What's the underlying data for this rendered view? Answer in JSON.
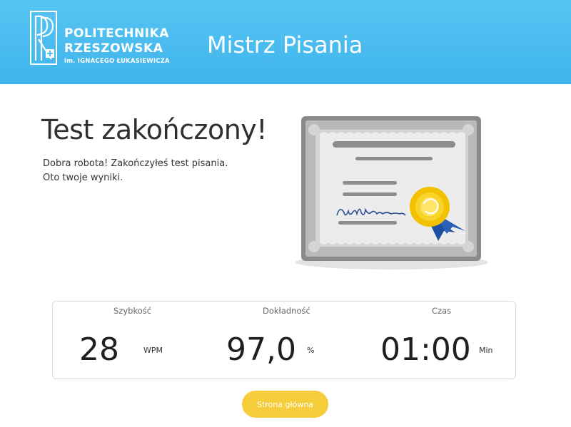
{
  "header": {
    "logo": {
      "line1": "POLITECHNIKA",
      "line2": "RZESZOWSKA",
      "line3": "im. IGNACEGO ŁUKASIEWICZA"
    },
    "app_title": "Mistrz Pisania"
  },
  "result": {
    "title": "Test zakończony!",
    "message_line1": "Dobra robota! Zakończyłeś test pisania.",
    "message_line2": "Oto twoje wyniki."
  },
  "stats": {
    "speed": {
      "label": "Szybkość",
      "value": "28",
      "unit": "WPM"
    },
    "accuracy": {
      "label": "Dokładność",
      "value": "97,0",
      "unit": "%"
    },
    "time": {
      "label": "Czas",
      "value": "01:00",
      "unit": "Min"
    }
  },
  "actions": {
    "home_label": "Strona główna"
  },
  "icons": {
    "logo": "politechnika-logo-icon",
    "certificate": "certificate-icon"
  },
  "colors": {
    "header_bg": "#4fbdf0",
    "button_bg": "#f5cd3a"
  }
}
